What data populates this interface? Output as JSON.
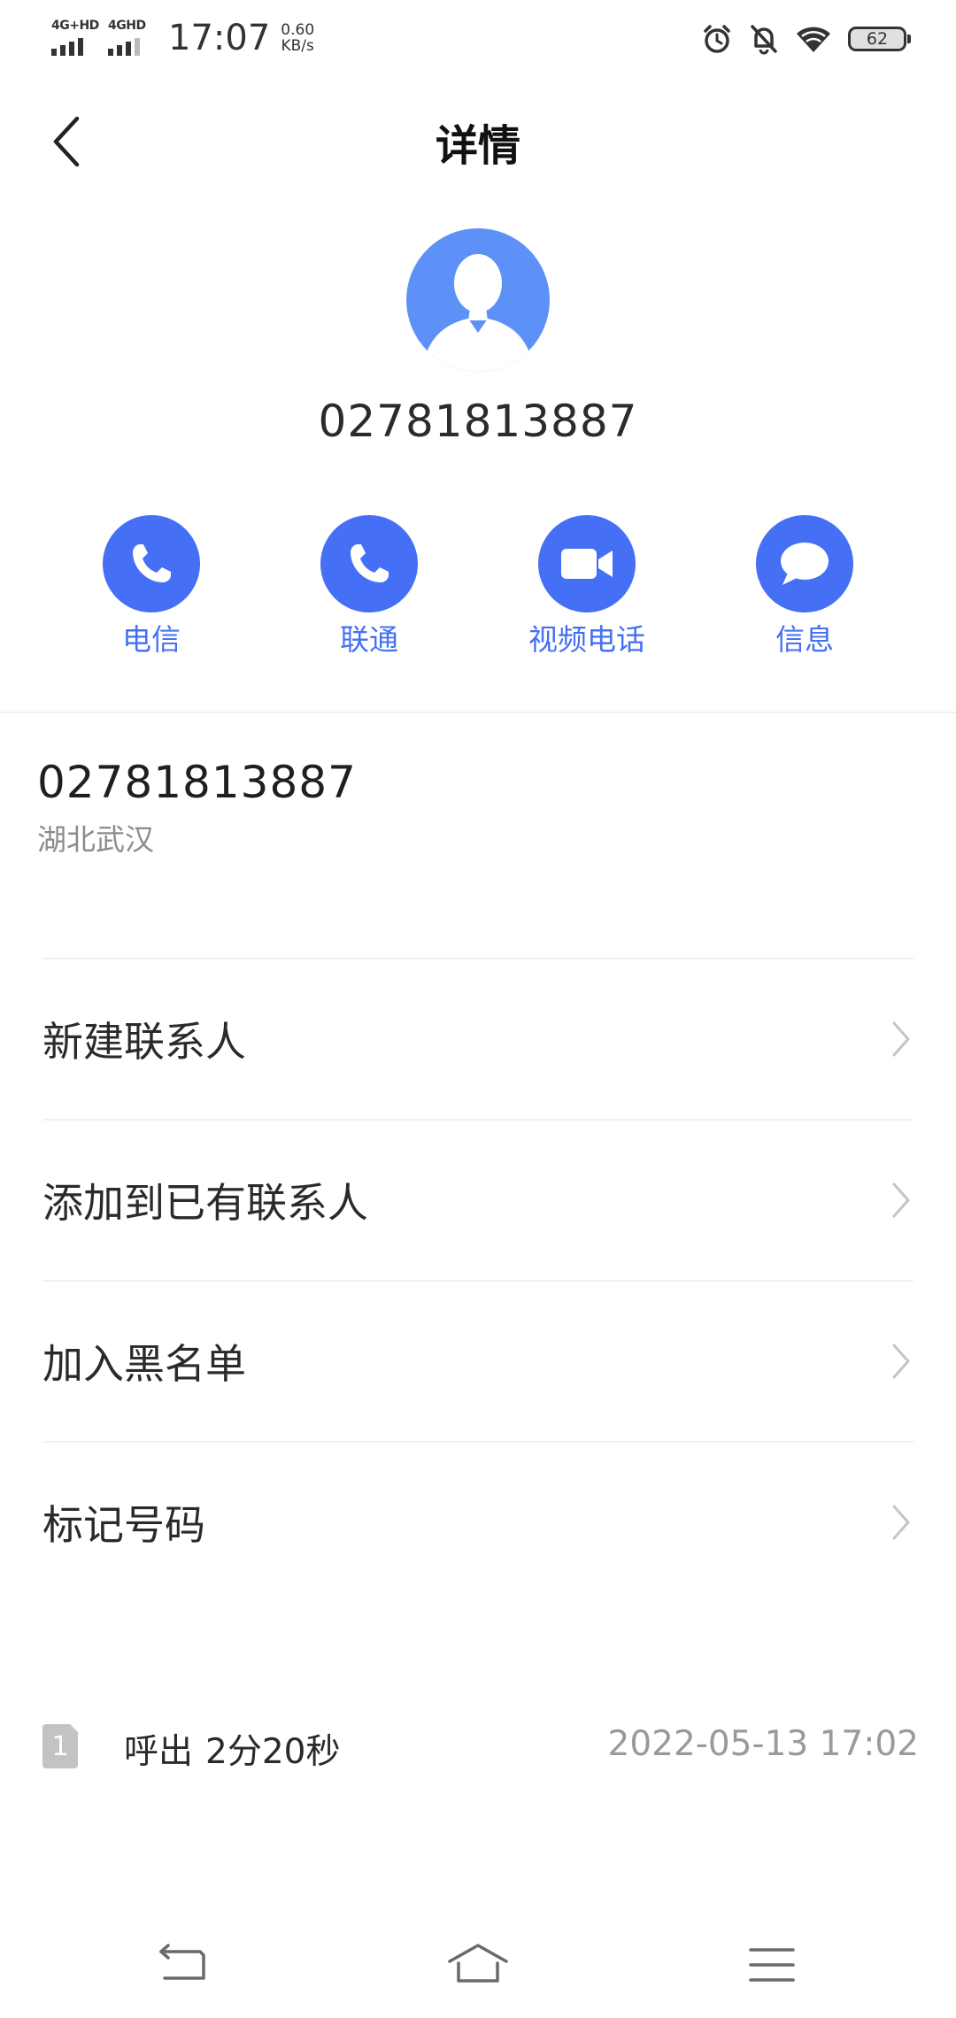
{
  "status_bar": {
    "sim1_network": "4G+HD",
    "sim2_network": "4GHD",
    "time": "17:07",
    "speed_value": "0.60",
    "speed_unit": "KB/s",
    "battery": "62"
  },
  "header": {
    "title": "详情",
    "number": "02781813887"
  },
  "actions": [
    {
      "label": "电信",
      "icon": "phone-icon"
    },
    {
      "label": "联通",
      "icon": "phone-icon"
    },
    {
      "label": "视频电话",
      "icon": "video-camera-icon"
    },
    {
      "label": "信息",
      "icon": "message-bubble-icon"
    }
  ],
  "info": {
    "number": "02781813887",
    "location": "湖北武汉"
  },
  "menu": [
    {
      "label": "新建联系人"
    },
    {
      "label": "添加到已有联系人"
    },
    {
      "label": "加入黑名单"
    },
    {
      "label": "标记号码"
    }
  ],
  "call_record": {
    "sim": "1",
    "type": "呼出",
    "duration": "2分20秒",
    "datetime": "2022-05-13 17:02"
  },
  "colors": {
    "accent": "#4570f5",
    "avatar": "#5e91f7"
  }
}
